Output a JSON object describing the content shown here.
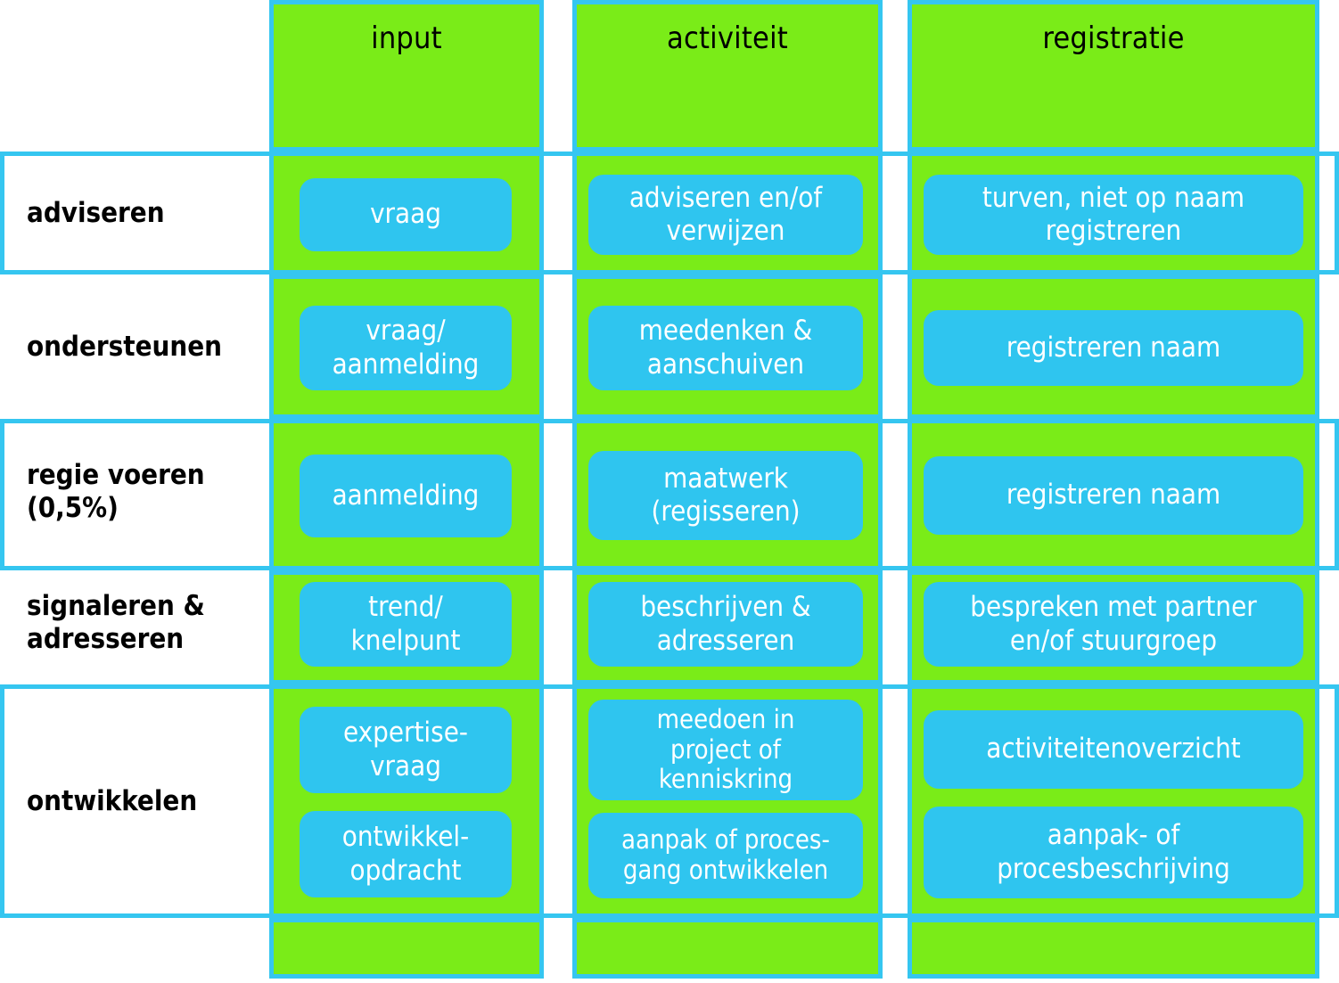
{
  "colors": {
    "green": "#7AEC18",
    "blue": "#2FC5EF",
    "border": "#35C6F0",
    "label_text": "#000000",
    "pill_text": "#FFFFFF"
  },
  "columns": [
    {
      "id": "input",
      "label": "input"
    },
    {
      "id": "activiteit",
      "label": "activiteit"
    },
    {
      "id": "registratie",
      "label": "registratie"
    }
  ],
  "rows": [
    {
      "id": "adviseren",
      "label": "adviseren",
      "label_lines": [
        "adviseren"
      ],
      "input": [
        "vraag"
      ],
      "activiteit": [
        "adviseren en/of\nverwijzen"
      ],
      "registratie": [
        "turven, niet op naam\nregistreren"
      ]
    },
    {
      "id": "ondersteunen",
      "label": "ondersteunen",
      "label_lines": [
        "ondersteunen"
      ],
      "input": [
        "vraag/\naanmelding"
      ],
      "activiteit": [
        "meedenken &\naanschuiven"
      ],
      "registratie": [
        "registreren naam"
      ]
    },
    {
      "id": "regie-voeren",
      "label": "regie voeren (0,5%)",
      "label_lines": [
        "regie voeren",
        "(0,5%)"
      ],
      "input": [
        "aanmelding"
      ],
      "activiteit": [
        "maatwerk\n(regisseren)"
      ],
      "registratie": [
        "registreren naam"
      ]
    },
    {
      "id": "signaleren-adresseren",
      "label": "signaleren & adresseren",
      "label_lines": [
        "signaleren &",
        "adresseren"
      ],
      "input": [
        "trend/\nknelpunt"
      ],
      "activiteit": [
        "beschrijven &\nadresseren"
      ],
      "registratie": [
        "bespreken met partner\nen/of stuurgroep"
      ]
    },
    {
      "id": "ontwikkelen",
      "label": "ontwikkelen",
      "label_lines": [
        "ontwikkelen"
      ],
      "input": [
        "expertise-\nvraag",
        "ontwikkel-\nopdracht"
      ],
      "activiteit": [
        "meedoen in\nproject of\nkenniskring",
        "aanpak of proces-\ngang ontwikkelen"
      ],
      "registratie": [
        "activiteitenoverzicht",
        "aanpak- of\nprocesbeschrijving"
      ]
    }
  ]
}
